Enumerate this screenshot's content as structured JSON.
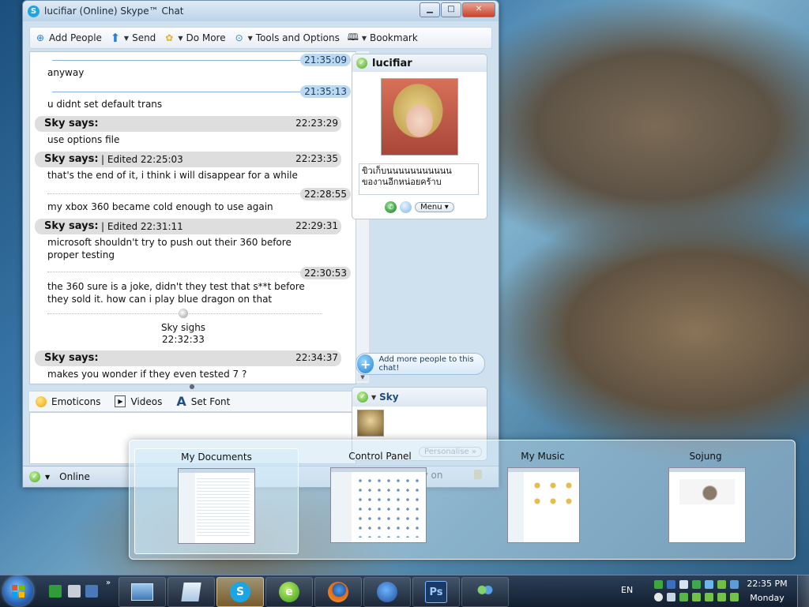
{
  "window": {
    "title": "lucifiar (Online) Skype™ Chat",
    "controls": {
      "minimize": "▁",
      "maximize": "□",
      "close": "✕"
    }
  },
  "toolbar": {
    "add_people": "Add People",
    "send": "Send",
    "do_more": "Do More",
    "tools": "Tools and Options",
    "bookmark": "Bookmark"
  },
  "chat": {
    "messages": [
      {
        "time": "21:35:09",
        "text": "anyway"
      },
      {
        "time": "21:35:13",
        "text": "u didnt set default trans"
      },
      {
        "sender": "Sky says:",
        "time": "22:23:29",
        "text": "use options file"
      },
      {
        "sender": "Sky says:",
        "edited": "| Edited 22:25:03",
        "time": "22:23:35",
        "text": "that's the end of it, i think i will disappear for a while"
      },
      {
        "time": "22:28:55",
        "text": "my xbox 360 became cold enough to use again"
      },
      {
        "sender": "Sky says:",
        "edited": "| Edited 22:31:11",
        "time": "22:29:31",
        "text": "microsoft shouldn't try to push out their 360 before proper testing"
      },
      {
        "time": "22:30:53",
        "text": "the 360 sure is a joke, didn't they test that s**t before they sold it. how can i play blue dragon on that"
      },
      {
        "emote": "Sky sighs",
        "time": "22:32:33"
      },
      {
        "sender": "Sky says:",
        "time": "22:34:37",
        "text": "makes you wonder if they even tested 7 ?"
      }
    ]
  },
  "format_bar": {
    "emoticons": "Emoticons",
    "videos": "Videos",
    "set_font": "Set Font"
  },
  "contact": {
    "name": "lucifiar",
    "mood_line1": "ขิวเก็บนนนนนนนนนนน",
    "mood_line2": "ของานอีกหน่อยคร้าบ",
    "menu": "Menu"
  },
  "add_more": "Add more people to this chat!",
  "self": {
    "name": "Sky",
    "personalise": "Personalise »"
  },
  "status": {
    "label": "Online",
    "history": "istory on"
  },
  "switcher": {
    "items": [
      {
        "label": "My Documents"
      },
      {
        "label": "Control Panel"
      },
      {
        "label": "My Music"
      },
      {
        "label": "Sojung"
      }
    ]
  },
  "taskbar": {
    "lang": "EN",
    "time": "22:35 PM",
    "day": "Monday",
    "apps": [
      "Skype",
      "Firefox",
      "Thunderbird",
      "Photoshop",
      "Messenger"
    ],
    "ps_label": "Ps"
  },
  "colors": {
    "accent": "#1ba6e3",
    "timestamp_bubble": "#bcd9f2",
    "says_bar": "#dedede",
    "online_green": "#4aa82a"
  }
}
